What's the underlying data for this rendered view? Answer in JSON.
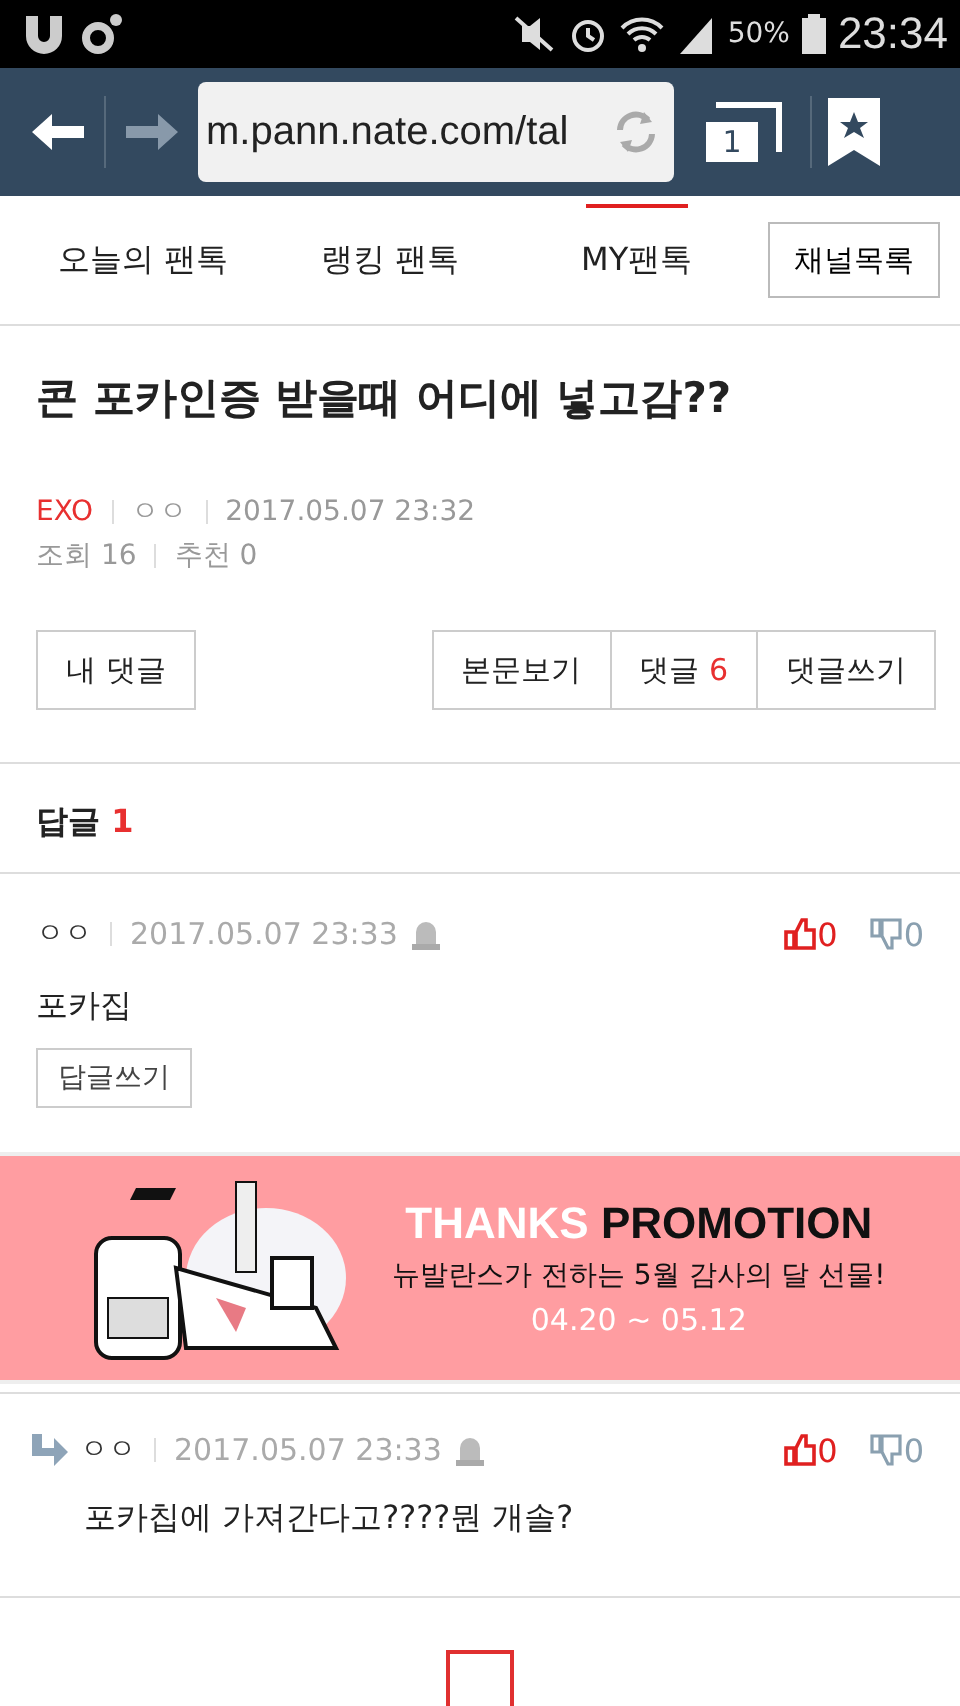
{
  "status_bar": {
    "battery": "50%",
    "time": "23:34"
  },
  "browser": {
    "url": "m.pann.nate.com/tal",
    "tab_count": "1"
  },
  "tabs": [
    {
      "label": "오늘의 팬톡",
      "selected": false
    },
    {
      "label": "랭킹 팬톡",
      "selected": false
    },
    {
      "label": "MY팬톡",
      "selected": true
    }
  ],
  "channel_button": "채널목록",
  "post": {
    "title": "콘 포카인증 받을때 어디에 넣고감??",
    "channel": "EXO",
    "author": "ㅇㅇ",
    "date": "2017.05.07 23:32",
    "views": "조회 16",
    "recommends": "추천 0"
  },
  "actions": {
    "my_comments": "내 댓글",
    "view_post": "본문보기",
    "comments_label": "댓글",
    "comments_count": "6",
    "write_comment": "댓글쓰기"
  },
  "replies_header": {
    "label": "답글",
    "count": "1"
  },
  "comments": [
    {
      "kind": "comment",
      "author": "ㅇㅇ",
      "date": "2017.05.07 23:33",
      "likes": "0",
      "dislikes": "0",
      "text": "포카집",
      "reply_button": "답글쓰기"
    },
    {
      "kind": "banner",
      "headline_light": "THANKS",
      "headline_dark": "PROMOTION",
      "subtitle": "뉴발란스가 전하는 5월 감사의 달 선물!",
      "dates": "04.20 ~ 05.12"
    },
    {
      "kind": "reply",
      "author": "ㅇㅇ",
      "date": "2017.05.07 23:33",
      "likes": "0",
      "dislikes": "0",
      "text": "포카칩에 가져간다고????뭔 개솔?"
    }
  ]
}
